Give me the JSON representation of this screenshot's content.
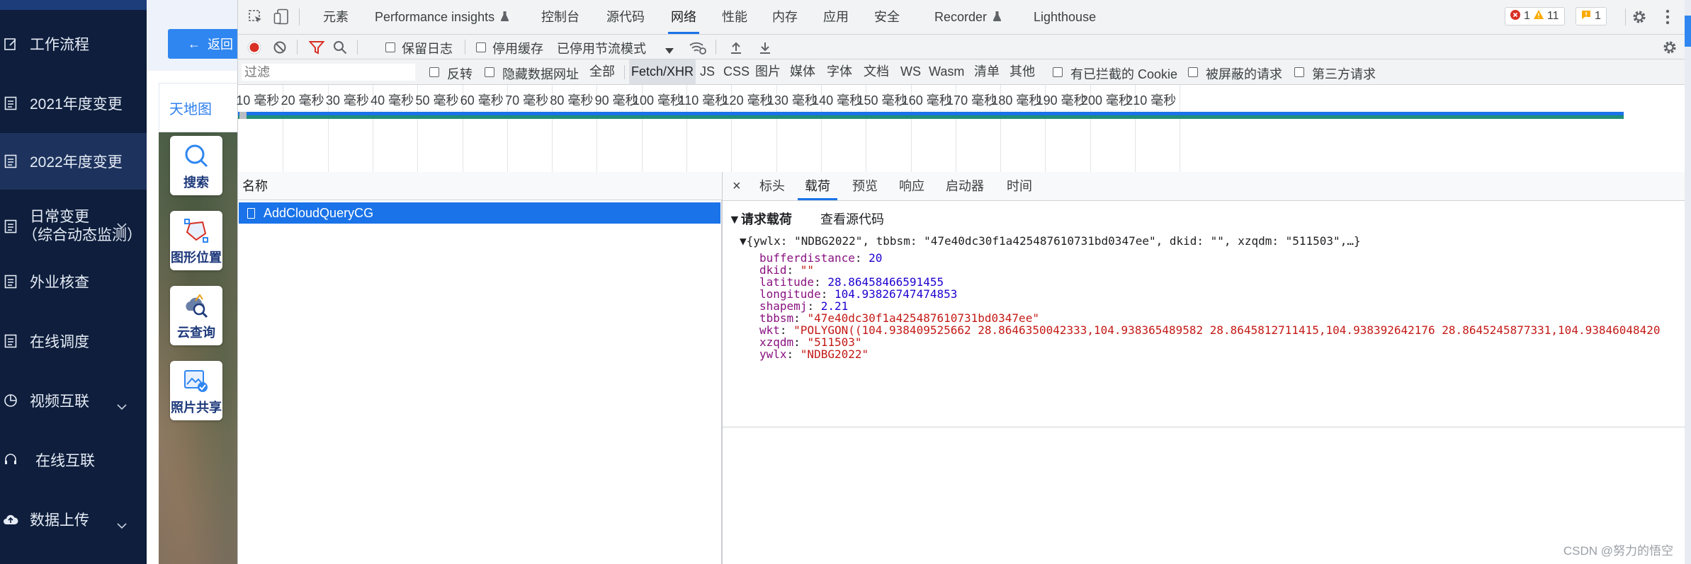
{
  "colors": {
    "sidebar_bg": "#0e1e3c",
    "sidebar_active": "#1d335d",
    "accent_blue": "#1a73e8",
    "app_button_blue": "#2f86f0",
    "record_red": "#d93025",
    "filter_red": "#d93025",
    "json_key": "#881280",
    "json_string": "#c41a16",
    "json_number": "#1c00cf"
  },
  "sidebar": {
    "items": [
      {
        "label": "工作流程",
        "icon": "document-edit-icon"
      },
      {
        "label": "2021年度变更",
        "icon": "document-icon"
      },
      {
        "label": "2022年度变更",
        "icon": "document-icon",
        "active": true
      },
      {
        "label": "日常变更",
        "label2": "（综合动态监测）",
        "icon": "document-icon",
        "has_children": true
      },
      {
        "label": "外业核查",
        "icon": "document-icon"
      },
      {
        "label": "在线调度",
        "icon": "document-icon"
      },
      {
        "label": "视频互联",
        "icon": "clock-icon",
        "has_children": true
      },
      {
        "label": "在线互联",
        "icon": "headset-icon"
      },
      {
        "label": "数据上传",
        "icon": "cloud-upload-icon",
        "has_children": true
      }
    ]
  },
  "map": {
    "back_label": "返回",
    "tab_label": "天地图",
    "tools": [
      {
        "label": "搜索",
        "icon": "search-icon"
      },
      {
        "label": "图形位置",
        "icon": "polygon-icon"
      },
      {
        "label": "云查询",
        "icon": "cloud-query-icon"
      },
      {
        "label": "照片共享",
        "icon": "photo-share-icon"
      }
    ]
  },
  "devtools": {
    "tabs": [
      "元素",
      "Performance insights",
      "控制台",
      "源代码",
      "网络",
      "性能",
      "内存",
      "应用",
      "安全",
      "Recorder",
      "Lighthouse"
    ],
    "selected_tab": "网络",
    "errors": "1",
    "warnings": "11",
    "issues": "1",
    "toolbar": {
      "preserve_log": "保留日志",
      "disable_cache": "停用缓存",
      "throttling": "已停用节流模式"
    },
    "filter": {
      "placeholder": "过滤",
      "invert": "反转",
      "hide_data_urls": "隐藏数据网址",
      "types": [
        "全部",
        "Fetch/XHR",
        "JS",
        "CSS",
        "图片",
        "媒体",
        "字体",
        "文档",
        "WS",
        "Wasm",
        "清单",
        "其他"
      ],
      "selected_type": "Fetch/XHR",
      "blocked_cookies": "有已拦截的 Cookie",
      "blocked_requests": "被屏蔽的请求",
      "third_party": "第三方请求"
    },
    "timeline_ticks": [
      "10 毫秒",
      "20 毫秒",
      "30 毫秒",
      "40 毫秒",
      "50 毫秒",
      "60 毫秒",
      "70 毫秒",
      "80 毫秒",
      "90 毫秒",
      "100 毫秒",
      "110 毫秒",
      "120 毫秒",
      "130 毫秒",
      "140 毫秒",
      "150 毫秒",
      "160 毫秒",
      "170 毫秒",
      "180 毫秒",
      "190 毫秒",
      "200 毫秒",
      "210 毫秒"
    ],
    "request_list": {
      "header": "名称",
      "rows": [
        "AddCloudQueryCG"
      ]
    },
    "details": {
      "close": "×",
      "tabs": [
        "标头",
        "载荷",
        "预览",
        "响应",
        "启动器",
        "时间"
      ],
      "selected_tab": "载荷",
      "section_title": "▼请求载荷",
      "view_source": "查看源代码",
      "summary": "▼{ywlx: \"NDBG2022\", tbbsm: \"47e40dc30f1a425487610731bd0347ee\", dkid: \"\", xzqdm: \"511503\",…}",
      "fields": [
        {
          "key": "bufferdistance",
          "value": "20",
          "kind": "number"
        },
        {
          "key": "dkid",
          "value": "\"\"",
          "kind": "string"
        },
        {
          "key": "latitude",
          "value": "28.86458466591455",
          "kind": "number"
        },
        {
          "key": "longitude",
          "value": "104.93826747474853",
          "kind": "number"
        },
        {
          "key": "shapemj",
          "value": "2.21",
          "kind": "number"
        },
        {
          "key": "tbbsm",
          "value": "\"47e40dc30f1a425487610731bd0347ee\"",
          "kind": "string"
        },
        {
          "key": "wkt",
          "value": "\"POLYGON((104.938409525662 28.8646350042333,104.938365489582 28.8645812711415,104.938392642176 28.8645245877331,104.93846048420",
          "kind": "string"
        },
        {
          "key": "xzqdm",
          "value": "\"511503\"",
          "kind": "string"
        },
        {
          "key": "ywlx",
          "value": "\"NDBG2022\"",
          "kind": "string"
        }
      ]
    }
  },
  "watermark": "CSDN @努力的悟空"
}
